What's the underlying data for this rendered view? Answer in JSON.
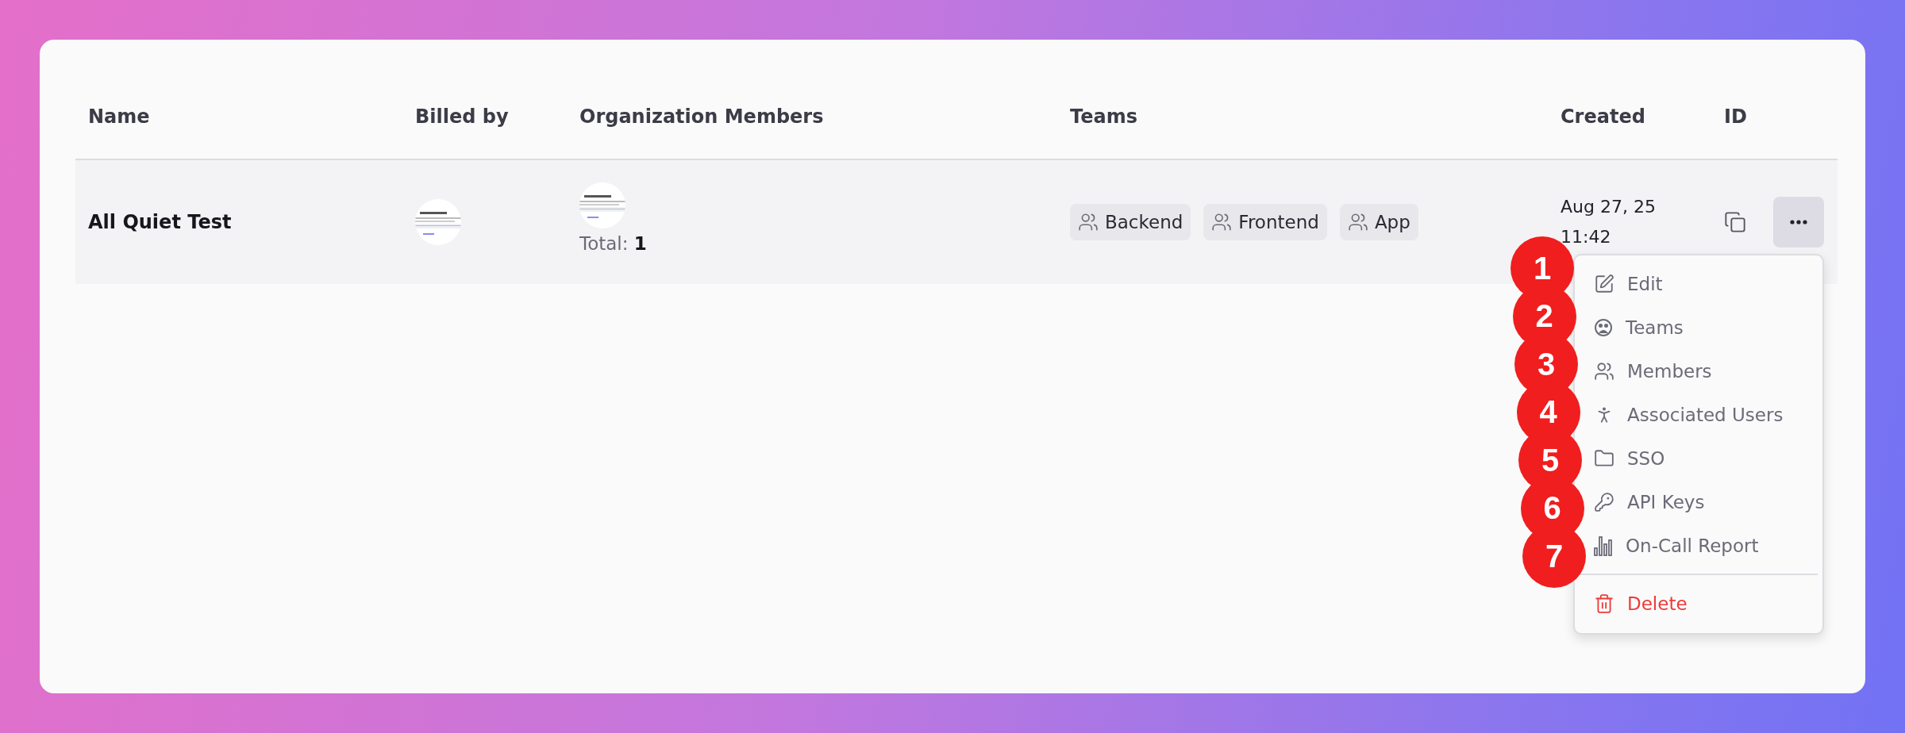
{
  "table": {
    "columns": [
      "Name",
      "Billed by",
      "Organization Members",
      "Teams",
      "Created",
      "ID"
    ],
    "rows": [
      {
        "name": "All Quiet Test",
        "billed_by": {
          "kind": "picture"
        },
        "members": {
          "avatar": {
            "kind": "picture"
          },
          "total_label": "Total:",
          "total": "1"
        },
        "teams": [
          "Backend",
          "Frontend",
          "App"
        ],
        "created": [
          "Aug 27, 25",
          "11:42"
        ],
        "menu_open": true
      }
    ]
  },
  "menu": {
    "items": [
      {
        "label": "Edit",
        "kind": "edit"
      },
      {
        "label": "Teams",
        "kind": "teams"
      },
      {
        "label": "Members",
        "kind": "members"
      },
      {
        "label": "Associated Users",
        "kind": "person"
      },
      {
        "label": "SSO",
        "kind": "folder"
      },
      {
        "label": "API Keys",
        "kind": "key"
      },
      {
        "label": "On-Call Report",
        "kind": "report"
      },
      {
        "label": "Delete",
        "kind": "delete"
      }
    ]
  },
  "callouts": [
    "1",
    "2",
    "3",
    "4",
    "5",
    "6",
    "7"
  ]
}
